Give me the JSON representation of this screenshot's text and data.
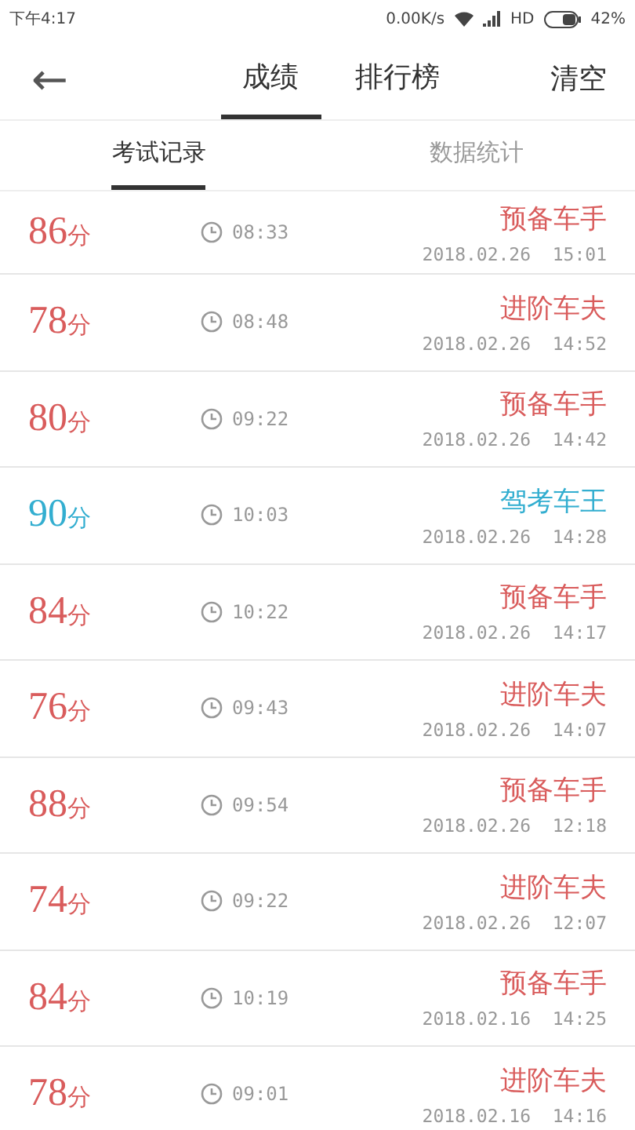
{
  "status_bar": {
    "time": "下午4:17",
    "speed": "0.00K/s",
    "network": "HD",
    "battery": "42%"
  },
  "nav": {
    "back": "←",
    "tabs": [
      {
        "label": "成绩",
        "selected": true
      },
      {
        "label": "排行榜",
        "selected": false
      }
    ],
    "action": "清空"
  },
  "sub_tabs": [
    {
      "label": "考试记录",
      "selected": true
    },
    {
      "label": "数据统计",
      "selected": false
    }
  ],
  "records": [
    {
      "score": "86",
      "unit": "分",
      "duration": "08:33",
      "title": "预备车手",
      "date": "2018.02.26  15:01",
      "color": "#d95c5c"
    },
    {
      "score": "78",
      "unit": "分",
      "duration": "08:48",
      "title": "进阶车夫",
      "date": "2018.02.26  14:52",
      "color": "#d95c5c"
    },
    {
      "score": "80",
      "unit": "分",
      "duration": "09:22",
      "title": "预备车手",
      "date": "2018.02.26  14:42",
      "color": "#d95c5c"
    },
    {
      "score": "90",
      "unit": "分",
      "duration": "10:03",
      "title": "驾考车王",
      "date": "2018.02.26  14:28",
      "color": "#33aed0"
    },
    {
      "score": "84",
      "unit": "分",
      "duration": "10:22",
      "title": "预备车手",
      "date": "2018.02.26  14:17",
      "color": "#d95c5c"
    },
    {
      "score": "76",
      "unit": "分",
      "duration": "09:43",
      "title": "进阶车夫",
      "date": "2018.02.26  14:07",
      "color": "#d95c5c"
    },
    {
      "score": "88",
      "unit": "分",
      "duration": "09:54",
      "title": "预备车手",
      "date": "2018.02.26  12:18",
      "color": "#d95c5c"
    },
    {
      "score": "74",
      "unit": "分",
      "duration": "09:22",
      "title": "进阶车夫",
      "date": "2018.02.26  12:07",
      "color": "#d95c5c"
    },
    {
      "score": "84",
      "unit": "分",
      "duration": "10:19",
      "title": "预备车手",
      "date": "2018.02.16  14:25",
      "color": "#d95c5c"
    },
    {
      "score": "78",
      "unit": "分",
      "duration": "09:01",
      "title": "进阶车夫",
      "date": "2018.02.16  14:16",
      "color": "#d95c5c"
    }
  ]
}
